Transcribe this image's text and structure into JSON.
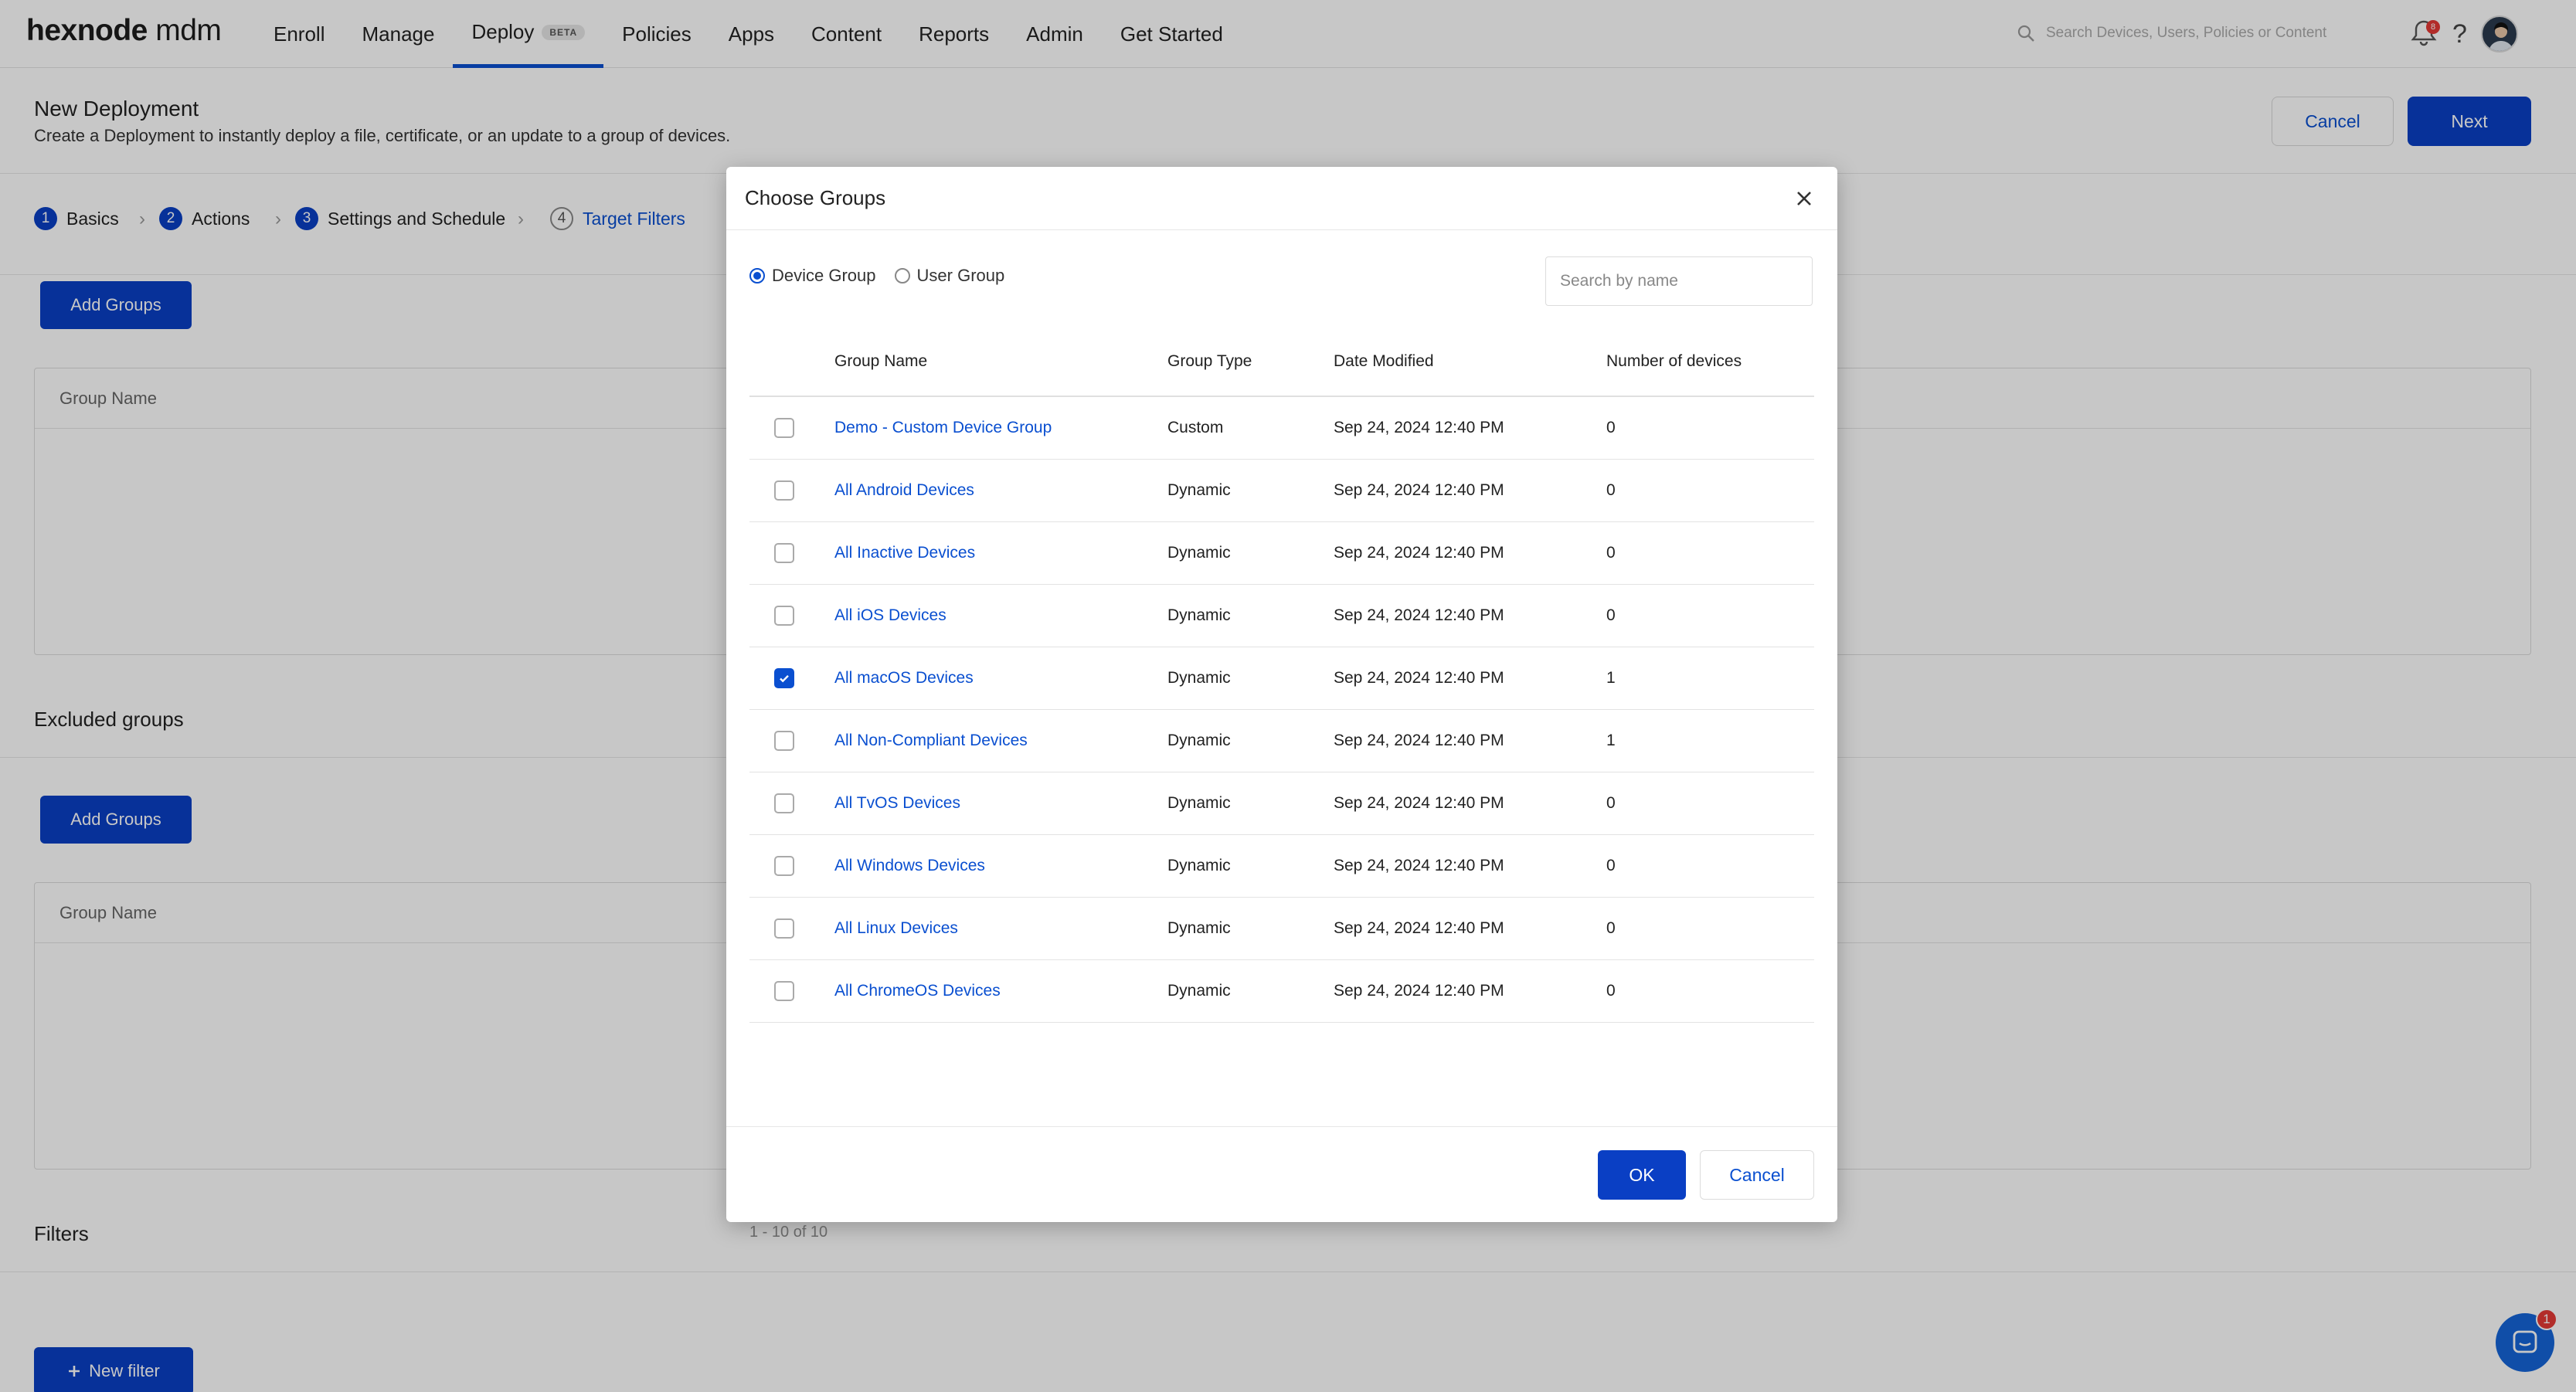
{
  "app": {
    "logo_bold": "hexnode",
    "logo_light": " mdm"
  },
  "nav": {
    "items": [
      "Enroll",
      "Manage",
      "Deploy",
      "Policies",
      "Apps",
      "Content",
      "Reports",
      "Admin",
      "Get Started"
    ],
    "active": "Deploy",
    "beta_label": "BETA",
    "search_placeholder": "Search Devices, Users, Policies or Content",
    "notification_count": "8"
  },
  "header": {
    "title": "New Deployment",
    "subtitle": "Create a Deployment to instantly deploy a file, certificate, or an update to a group of devices.",
    "cancel_label": "Cancel",
    "next_label": "Next"
  },
  "steps": [
    {
      "num": "1",
      "label": "Basics"
    },
    {
      "num": "2",
      "label": "Actions"
    },
    {
      "num": "3",
      "label": "Settings and Schedule"
    },
    {
      "num": "4",
      "label": "Target Filters"
    }
  ],
  "included": {
    "add_groups_label": "Add Groups",
    "column": "Group Name"
  },
  "excluded": {
    "title": "Excluded groups",
    "add_groups_label": "Add Groups",
    "column": "Group Name"
  },
  "filters": {
    "title": "Filters",
    "new_filter_label": "New filter"
  },
  "chat": {
    "badge": "1"
  },
  "modal": {
    "title": "Choose Groups",
    "radio_device": "Device Group",
    "radio_user": "User Group",
    "selected_radio": "device",
    "search_placeholder": "Search by name",
    "columns": {
      "name": "Group Name",
      "type": "Group Type",
      "date": "Date Modified",
      "count": "Number of devices"
    },
    "rows": [
      {
        "name": "Demo - Custom Device Group",
        "type": "Custom",
        "date": "Sep 24, 2024 12:40 PM",
        "count": "0",
        "checked": false
      },
      {
        "name": "All Android Devices",
        "type": "Dynamic",
        "date": "Sep 24, 2024 12:40 PM",
        "count": "0",
        "checked": false
      },
      {
        "name": "All Inactive Devices",
        "type": "Dynamic",
        "date": "Sep 24, 2024 12:40 PM",
        "count": "0",
        "checked": false
      },
      {
        "name": "All iOS Devices",
        "type": "Dynamic",
        "date": "Sep 24, 2024 12:40 PM",
        "count": "0",
        "checked": false
      },
      {
        "name": "All macOS Devices",
        "type": "Dynamic",
        "date": "Sep 24, 2024 12:40 PM",
        "count": "1",
        "checked": true
      },
      {
        "name": "All Non-Compliant Devices",
        "type": "Dynamic",
        "date": "Sep 24, 2024 12:40 PM",
        "count": "1",
        "checked": false
      },
      {
        "name": "All TvOS Devices",
        "type": "Dynamic",
        "date": "Sep 24, 2024 12:40 PM",
        "count": "0",
        "checked": false
      },
      {
        "name": "All Windows Devices",
        "type": "Dynamic",
        "date": "Sep 24, 2024 12:40 PM",
        "count": "0",
        "checked": false
      },
      {
        "name": "All Linux Devices",
        "type": "Dynamic",
        "date": "Sep 24, 2024 12:40 PM",
        "count": "0",
        "checked": false
      },
      {
        "name": "All ChromeOS Devices",
        "type": "Dynamic",
        "date": "Sep 24, 2024 12:40 PM",
        "count": "0",
        "checked": false
      }
    ],
    "pager": "1 - 10 of 10",
    "ok_label": "OK",
    "cancel_label": "Cancel"
  },
  "colors": {
    "accent": "#0a3fc4",
    "link": "#0a4fd0",
    "badge": "#e53935"
  }
}
